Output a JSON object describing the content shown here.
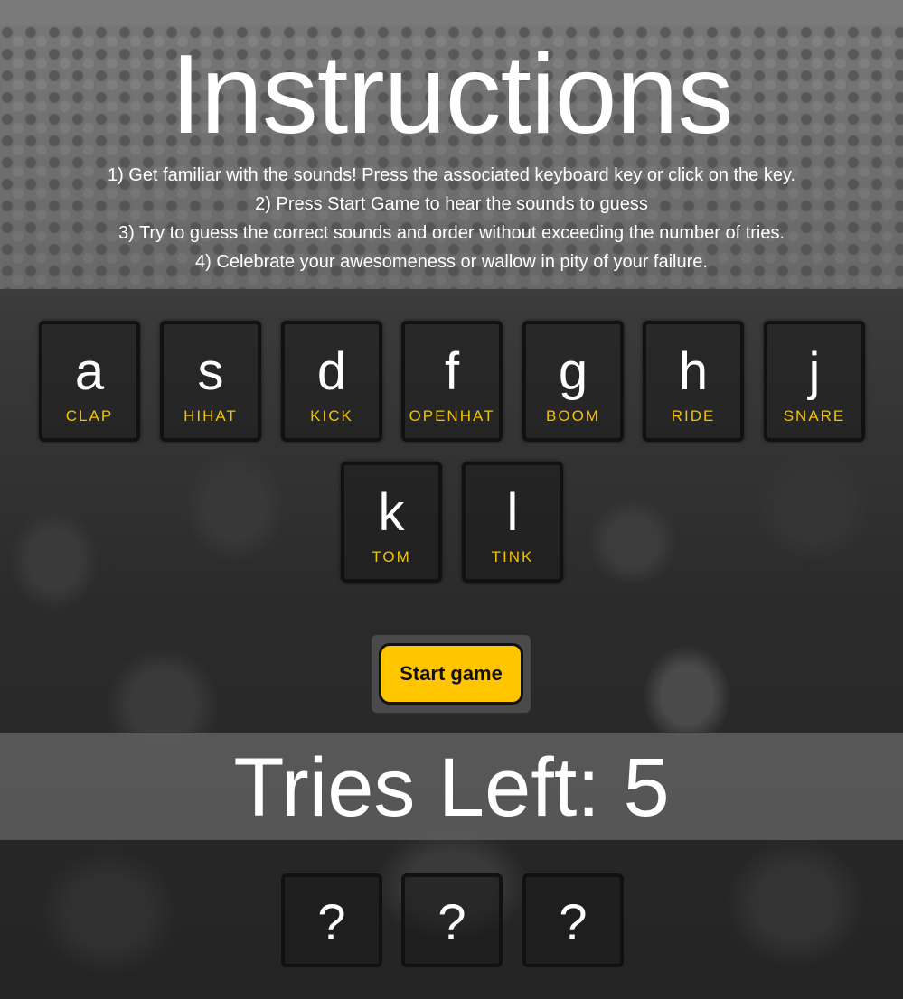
{
  "page": {
    "title": "Instructions"
  },
  "instructions": [
    "1) Get familiar with the sounds! Press the associated keyboard key or click on the key.",
    "2) Press Start Game to hear the sounds to guess",
    "3) Try to guess the correct sounds and order without exceeding the number of tries.",
    "4) Celebrate your awesomeness or wallow in pity of your failure."
  ],
  "keys": [
    {
      "key": "a",
      "sound": "CLAP"
    },
    {
      "key": "s",
      "sound": "HIHAT"
    },
    {
      "key": "d",
      "sound": "KICK"
    },
    {
      "key": "f",
      "sound": "OPENHAT"
    },
    {
      "key": "g",
      "sound": "BOOM"
    },
    {
      "key": "h",
      "sound": "RIDE"
    },
    {
      "key": "j",
      "sound": "SNARE"
    },
    {
      "key": "k",
      "sound": "TOM"
    },
    {
      "key": "l",
      "sound": "TINK"
    }
  ],
  "start_button": {
    "label": "Start game"
  },
  "tries": {
    "text": "Tries Left: 5",
    "remaining": 5
  },
  "guesses": [
    "?",
    "?",
    "?"
  ],
  "colors": {
    "accent": "#ffc600",
    "sound_label": "#f2c200"
  }
}
